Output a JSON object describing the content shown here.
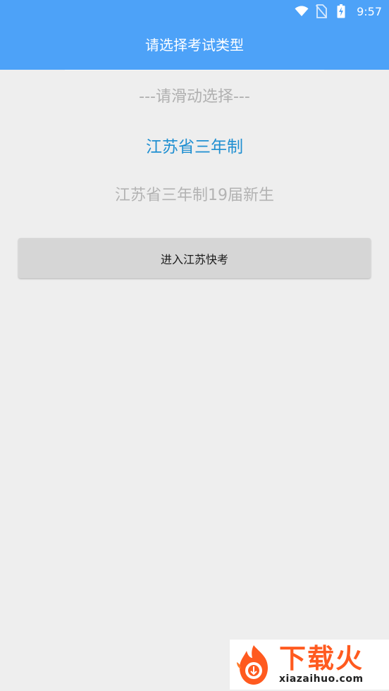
{
  "status_bar": {
    "time": "9:57",
    "icons": [
      "wifi-icon",
      "no-sim-icon",
      "battery-charging-icon"
    ]
  },
  "header": {
    "title": "请选择考试类型",
    "background_color": "#4da2f8"
  },
  "picker": {
    "hint": "---请滑动选择---",
    "options": [
      "江苏省三年制",
      "江苏省三年制19届新生"
    ],
    "selected_index": 0,
    "selected_color": "#1f8fd1"
  },
  "actions": {
    "enter_label": "进入江苏快考"
  },
  "watermark": {
    "cn_text": "下载火",
    "domain_text": "xiazaihuo.com",
    "brand_color": "#ff5a1f"
  }
}
